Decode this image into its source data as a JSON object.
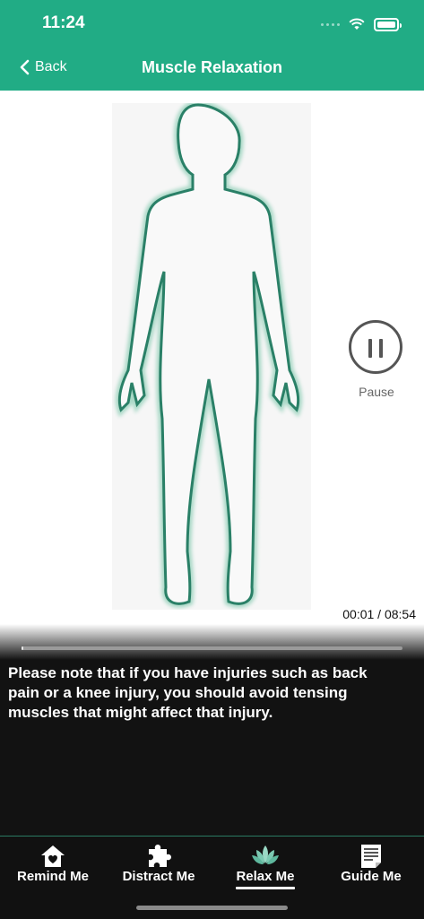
{
  "status_bar": {
    "time": "11:24"
  },
  "nav": {
    "back_label": "Back",
    "title": "Muscle Relaxation"
  },
  "player": {
    "pause_label": "Pause",
    "time_display": "00:01 / 08:54",
    "progress_fraction": 0.002,
    "caption": "Please note that if you have injuries such as back pain or a knee injury, you should avoid tensing muscles that might affect that injury."
  },
  "tabs": [
    {
      "label": "Remind Me",
      "icon": "home-heart-icon",
      "active": false
    },
    {
      "label": "Distract Me",
      "icon": "puzzle-icon",
      "active": false
    },
    {
      "label": "Relax Me",
      "icon": "lotus-icon",
      "active": true
    },
    {
      "label": "Guide Me",
      "icon": "document-icon",
      "active": false
    }
  ],
  "colors": {
    "header": "#21ac85",
    "outline": "#2a8067",
    "dark_panel": "#121212"
  }
}
